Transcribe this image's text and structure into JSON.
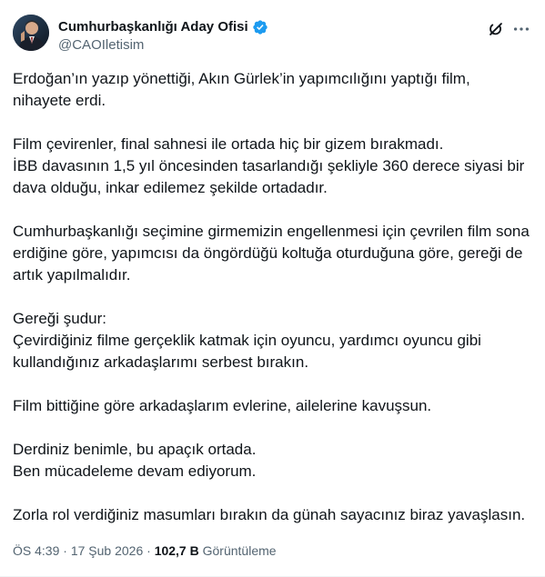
{
  "author": {
    "display_name": "Cumhurbaşkanlığı Aday Ofisi",
    "handle": "@CAOIletisim",
    "verified": true,
    "verified_color": "#1d9bf0"
  },
  "header_icons": {
    "grok": "grok-icon",
    "more": "more-icon"
  },
  "tweet": {
    "paragraphs": [
      [
        "Erdoğan’ın yazıp yönettiği, Akın Gürlek’in yapımcılığını yaptığı film, nihayete erdi."
      ],
      [
        "Film çevirenler, final sahnesi ile ortada hiç bir gizem bırakmadı.",
        "İBB davasının 1,5 yıl öncesinden tasarlandığı şekliyle 360 derece siyasi bir dava olduğu, inkar edilemez şekilde ortadadır."
      ],
      [
        "Cumhurbaşkanlığı seçimine girmemizin engellenmesi için çevrilen film sona erdiğine göre, yapımcısı da öngördüğü koltuğa oturduğuna göre, gereği de artık yapılmalıdır."
      ],
      [
        "Gereği şudur:",
        "Çevirdiğiniz filme gerçeklik katmak için oyuncu, yardımcı oyuncu gibi kullandığınız arkadaşlarımı serbest bırakın."
      ],
      [
        "Film bittiğine göre arkadaşlarım evlerine, ailelerine kavuşsun."
      ],
      [
        "Derdiniz benimle, bu apaçık ortada.",
        "Ben mücadeleme devam ediyorum."
      ],
      [
        "Zorla rol verdiğiniz masumları bırakın da günah sayacınız biraz yavaşlasın."
      ]
    ]
  },
  "meta": {
    "time": "ÖS 4:39",
    "separator": "·",
    "date": "17 Şub 2026",
    "views_count": "102,7 B",
    "views_label": "Görüntüleme"
  }
}
